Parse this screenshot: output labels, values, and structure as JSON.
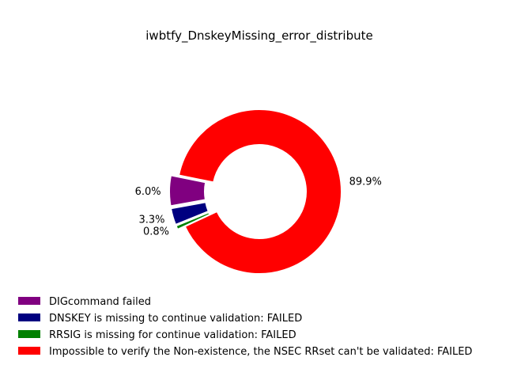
{
  "chart_data": {
    "type": "pie",
    "title": "iwbtfy_DnskeyMissing_error_distribute",
    "donut": true,
    "legend_position": "bottom-left",
    "slices": [
      {
        "label": "Impossible to verify the Non-existence, the NSEC RRset can't be validated: FAILED",
        "value": 89.9,
        "pct_text": "89.9%",
        "color": "#ff0000",
        "explode": false
      },
      {
        "label": "DIGcommand failed",
        "value": 6.0,
        "pct_text": "6.0%",
        "color": "#800080",
        "explode": true
      },
      {
        "label": "DNSKEY is missing to continue validation: FAILED",
        "value": 3.3,
        "pct_text": "3.3%",
        "color": "#000080",
        "explode": true
      },
      {
        "label": "RRSIG is missing for continue validation: FAILED",
        "value": 0.8,
        "pct_text": "0.8%",
        "color": "#008000",
        "explode": true
      }
    ],
    "legend": [
      {
        "label": "DIGcommand failed",
        "color": "#800080"
      },
      {
        "label": "DNSKEY is missing to continue validation: FAILED",
        "color": "#000080"
      },
      {
        "label": "RRSIG is missing for continue validation: FAILED",
        "color": "#008000"
      },
      {
        "label": "Impossible to verify the Non-existence, the NSEC RRset can't be validated: FAILED",
        "color": "#ff0000"
      }
    ]
  }
}
